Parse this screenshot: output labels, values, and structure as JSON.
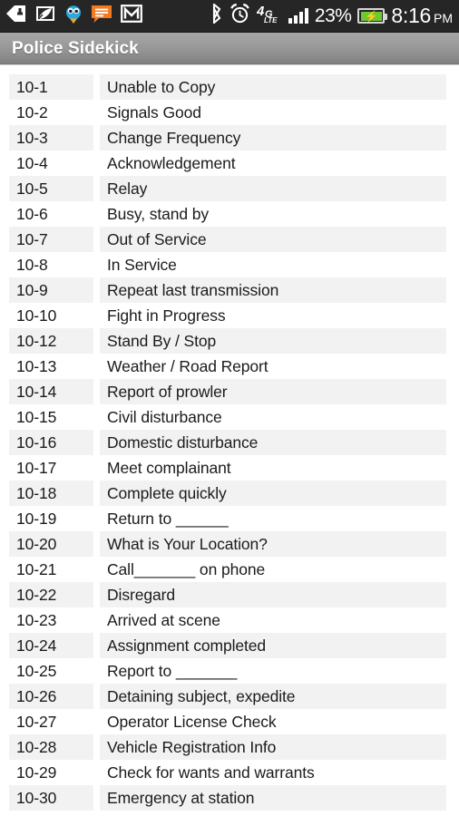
{
  "status_bar": {
    "notification_icons": [
      {
        "name": "download-arrow-icon",
        "label": "Download"
      },
      {
        "name": "evernote-leaf-icon",
        "label": "Evernote"
      },
      {
        "name": "twitter-bird-icon",
        "label": "Twitter"
      },
      {
        "name": "message-bubble-icon",
        "label": "Messages"
      },
      {
        "name": "gmail-icon",
        "label": "Gmail"
      }
    ],
    "system_icons": [
      {
        "name": "bluetooth-icon",
        "label": "Bluetooth"
      },
      {
        "name": "alarm-clock-icon",
        "label": "Alarm"
      },
      {
        "name": "network-4g-lte-icon",
        "label": "4G LTE"
      },
      {
        "name": "signal-bars-icon",
        "label": "Signal"
      }
    ],
    "network_type": "4G",
    "network_sub": "LTE",
    "signal_bars_filled": 4,
    "signal_bars_total": 4,
    "battery_percent": "23%",
    "battery_charging": true,
    "battery_bolt_glyph": "⚡",
    "time": "8:16",
    "am_pm": "PM"
  },
  "title_bar": {
    "title": "Police Sidekick"
  },
  "colors": {
    "status_bar_bg": "#262626",
    "title_bar_top": "#a6a6a6",
    "title_bar_bottom": "#6f6f6f",
    "row_alt_bg": "#f2f2f2",
    "row_bg": "#ffffff",
    "text": "#1b1b1b",
    "battery_green": "#6ec92e"
  },
  "code_list": {
    "rows": [
      {
        "code": "10-1",
        "description": "Unable to Copy"
      },
      {
        "code": "10-2",
        "description": "Signals Good"
      },
      {
        "code": "10-3",
        "description": "Change Frequency"
      },
      {
        "code": "10-4",
        "description": "Acknowledgement"
      },
      {
        "code": "10-5",
        "description": "Relay"
      },
      {
        "code": "10-6",
        "description": "Busy, stand by"
      },
      {
        "code": "10-7",
        "description": "Out of Service"
      },
      {
        "code": "10-8",
        "description": "In Service"
      },
      {
        "code": "10-9",
        "description": "Repeat last transmission"
      },
      {
        "code": "10-10",
        "description": "Fight in Progress"
      },
      {
        "code": "10-12",
        "description": "Stand By / Stop"
      },
      {
        "code": "10-13",
        "description": "Weather / Road Report"
      },
      {
        "code": "10-14",
        "description": "Report of prowler"
      },
      {
        "code": "10-15",
        "description": "Civil disturbance"
      },
      {
        "code": "10-16",
        "description": "Domestic disturbance"
      },
      {
        "code": "10-17",
        "description": "Meet complainant"
      },
      {
        "code": "10-18",
        "description": "Complete quickly"
      },
      {
        "code": "10-19",
        "description": "Return to ______"
      },
      {
        "code": "10-20",
        "description": "What is Your Location?"
      },
      {
        "code": "10-21",
        "description": "Call_______ on phone"
      },
      {
        "code": "10-22",
        "description": "Disregard"
      },
      {
        "code": "10-23",
        "description": "Arrived at scene"
      },
      {
        "code": "10-24",
        "description": "Assignment completed"
      },
      {
        "code": "10-25",
        "description": "Report to _______"
      },
      {
        "code": "10-26",
        "description": "Detaining subject, expedite"
      },
      {
        "code": "10-27",
        "description": "Operator License Check"
      },
      {
        "code": "10-28",
        "description": "Vehicle Registration Info"
      },
      {
        "code": "10-29",
        "description": "Check for wants and warrants"
      },
      {
        "code": "10-30",
        "description": "Emergency at station"
      }
    ]
  }
}
